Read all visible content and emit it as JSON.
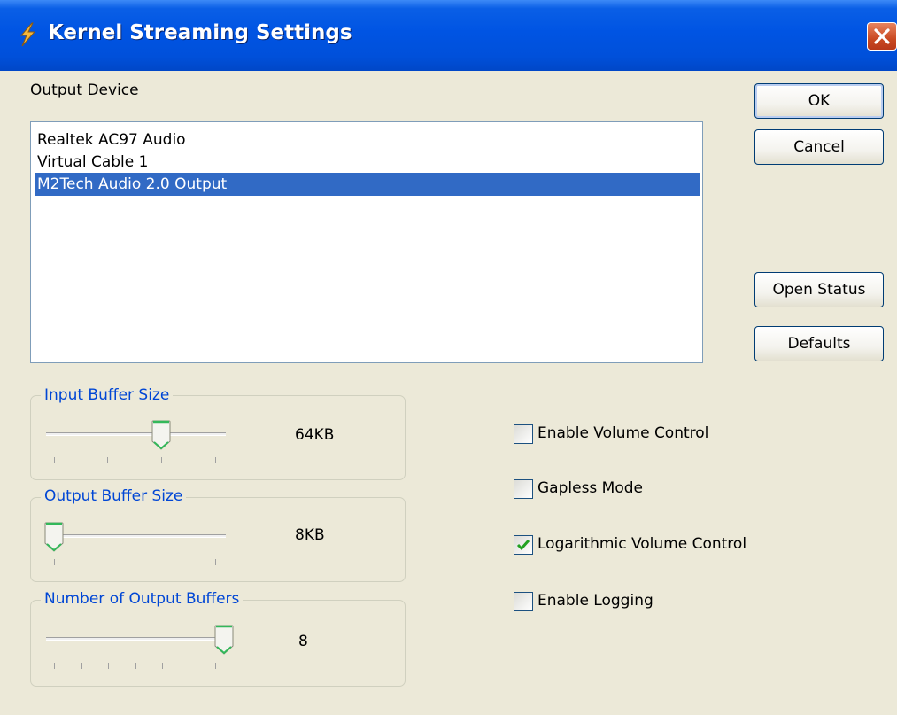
{
  "window": {
    "title": "Kernel Streaming Settings"
  },
  "output_device": {
    "label": "Output Device",
    "items": [
      "Realtek AC97 Audio",
      "Virtual Cable 1",
      "M2Tech Audio 2.0 Output"
    ],
    "selected_index": 2
  },
  "buttons": {
    "ok": "OK",
    "cancel": "Cancel",
    "open_status": "Open Status",
    "defaults": "Defaults"
  },
  "input_buffer": {
    "title": "Input Buffer Size",
    "value": "64KB",
    "position": 2,
    "steps": 3
  },
  "output_buffer": {
    "title": "Output Buffer Size",
    "value": "8KB",
    "position": 0,
    "steps": 3
  },
  "num_buffers": {
    "title": "Number of Output Buffers",
    "value": "8",
    "position": 6,
    "steps": 6
  },
  "checkboxes": [
    {
      "label": "Enable Volume Control",
      "checked": false
    },
    {
      "label": "Gapless Mode",
      "checked": false
    },
    {
      "label": "Logarithmic Volume Control",
      "checked": true
    },
    {
      "label": "Enable Logging",
      "checked": false
    }
  ],
  "colors": {
    "titlebar": "#0054e3",
    "selection": "#316ac5",
    "group_title": "#0046d5",
    "face": "#ece9d8"
  }
}
